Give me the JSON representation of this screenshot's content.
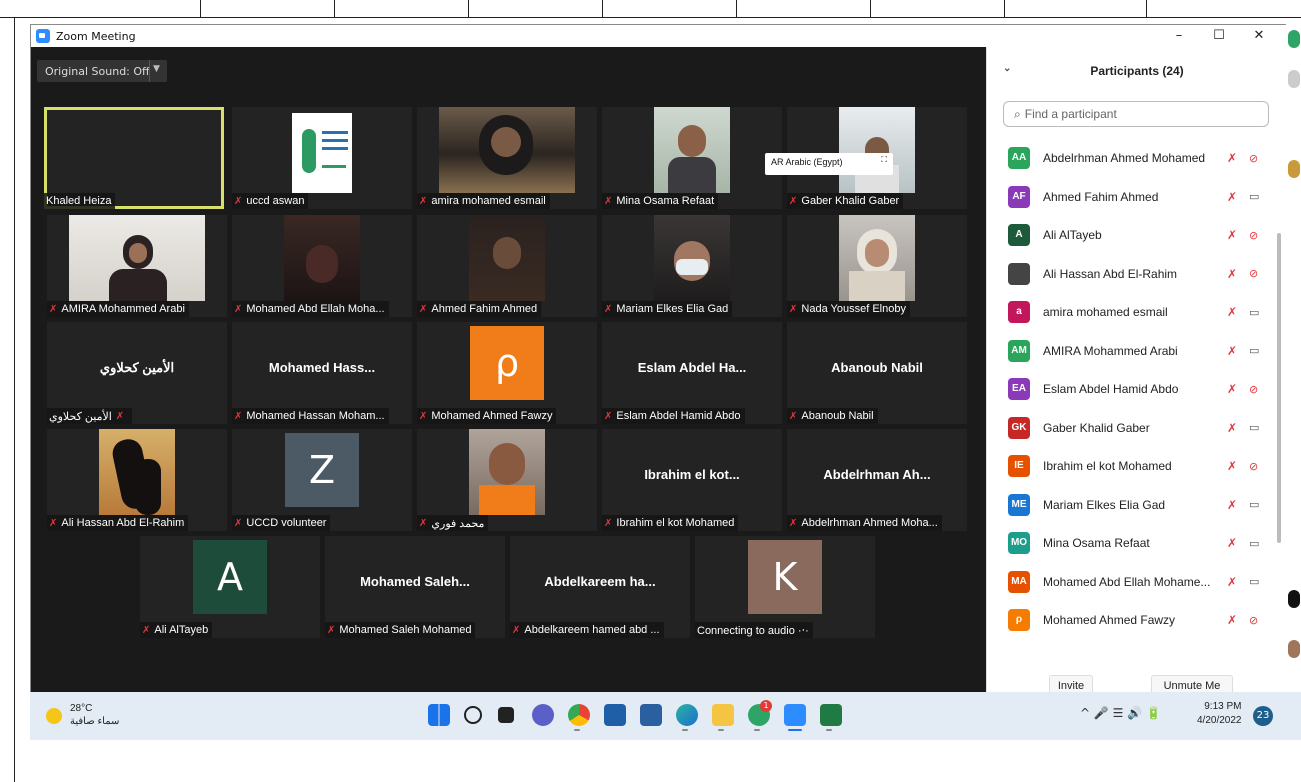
{
  "window": {
    "title": "Zoom Meeting",
    "min": "–",
    "max": "☐",
    "close": "✕"
  },
  "toolbar": {
    "original_sound": "Original Sound: Off"
  },
  "language_popup": {
    "text": "AR Arabic (Egypt)"
  },
  "tiles": [
    {
      "label": "Khaled Heiza",
      "kind": "blank"
    },
    {
      "label": "uccd aswan",
      "kind": "logo"
    },
    {
      "label": "amira mohamed esmail",
      "kind": "photo"
    },
    {
      "label": "Mina Osama Refaat",
      "kind": "photo"
    },
    {
      "label": "Gaber Khalid Gaber",
      "kind": "photo"
    },
    {
      "label": "AMIRA Mohammed Arabi",
      "kind": "photo"
    },
    {
      "label": "Mohamed Abd Ellah Moha...",
      "kind": "photo"
    },
    {
      "label": "Ahmed Fahim Ahmed",
      "kind": "photo"
    },
    {
      "label": "Mariam Elkes Elia Gad",
      "kind": "photo"
    },
    {
      "label": "Nada Youssef Elnoby",
      "kind": "photo"
    },
    {
      "label": "الأمين كحلاوي",
      "big": "الأمين كحلاوي",
      "kind": "text"
    },
    {
      "label": "Mohamed Hassan Moham...",
      "big": "Mohamed  Hass...",
      "kind": "text"
    },
    {
      "label": "Mohamed Ahmed Fawzy",
      "avatar": "ρ",
      "kind": "avatar"
    },
    {
      "label": "Eslam Abdel Hamid Abdo",
      "big": "Eslam  Abdel  Ha...",
      "kind": "text"
    },
    {
      "label": "Abanoub Nabil",
      "big": "Abanoub Nabil",
      "kind": "text"
    },
    {
      "label": "Ali Hassan Abd El-Rahim",
      "kind": "photo"
    },
    {
      "label": "UCCD volunteer",
      "avatar": "Z",
      "kind": "avatar"
    },
    {
      "label": "محمد فوري",
      "kind": "photo"
    },
    {
      "label": "Ibrahim el kot Mohamed",
      "big": "Ibrahim  el  kot...",
      "kind": "text"
    },
    {
      "label": "Abdelrhman Ahmed Moha...",
      "big": "Abdelrhman  Ah...",
      "kind": "text"
    },
    {
      "label": "Ali AlTayeb",
      "avatar": "A",
      "kind": "avatar"
    },
    {
      "label": "Mohamed Saleh Mohamed",
      "big": "Mohamed  Saleh...",
      "kind": "text"
    },
    {
      "label": "Abdelkareem hamed abd ...",
      "big": "Abdelkareem  ha...",
      "kind": "text"
    },
    {
      "label": "Connecting to audio ·‧·",
      "avatar": "K",
      "kind": "avatar"
    }
  ],
  "panel": {
    "title": "Participants (24)",
    "search_placeholder": "Find a participant",
    "invite": "Invite",
    "unmute": "Unmute Me",
    "participants": [
      {
        "initials": "AA",
        "name": "Abdelrhman Ahmed Mohamed",
        "color": "#2aa55b",
        "cam": "off"
      },
      {
        "initials": "AF",
        "name": "Ahmed Fahim Ahmed",
        "color": "#8a3ab9",
        "cam": "on"
      },
      {
        "initials": "A",
        "name": "Ali AlTayeb",
        "color": "#1d5a3a",
        "cam": "off"
      },
      {
        "initials": "",
        "name": "Ali Hassan Abd El-Rahim",
        "color": "#444444",
        "cam": "off"
      },
      {
        "initials": "a",
        "name": "amira mohamed esmail",
        "color": "#c2185b",
        "cam": "on"
      },
      {
        "initials": "AM",
        "name": "AMIRA Mohammed Arabi",
        "color": "#2aa55b",
        "cam": "on"
      },
      {
        "initials": "EA",
        "name": "Eslam Abdel Hamid Abdo",
        "color": "#8a3ab9",
        "cam": "off"
      },
      {
        "initials": "GK",
        "name": "Gaber Khalid Gaber",
        "color": "#c62828",
        "cam": "on"
      },
      {
        "initials": "IE",
        "name": "Ibrahim el kot Mohamed",
        "color": "#e65100",
        "cam": "off"
      },
      {
        "initials": "ME",
        "name": "Mariam Elkes Elia Gad",
        "color": "#1976d2",
        "cam": "on"
      },
      {
        "initials": "MO",
        "name": "Mina Osama Refaat",
        "color": "#1e9e8a",
        "cam": "on"
      },
      {
        "initials": "MA",
        "name": "Mohamed Abd Ellah Mohame...",
        "color": "#e65100",
        "cam": "on"
      },
      {
        "initials": "ρ",
        "name": "Mohamed Ahmed Fawzy",
        "color": "#f57c00",
        "cam": "off"
      }
    ]
  },
  "taskbar": {
    "temp": "28°C",
    "condition": "سماء صافية",
    "time": "9:13 PM",
    "date": "4/20/2022",
    "notifications": "23",
    "tray": "^  🎤  ☰ 🔊 🔋"
  }
}
